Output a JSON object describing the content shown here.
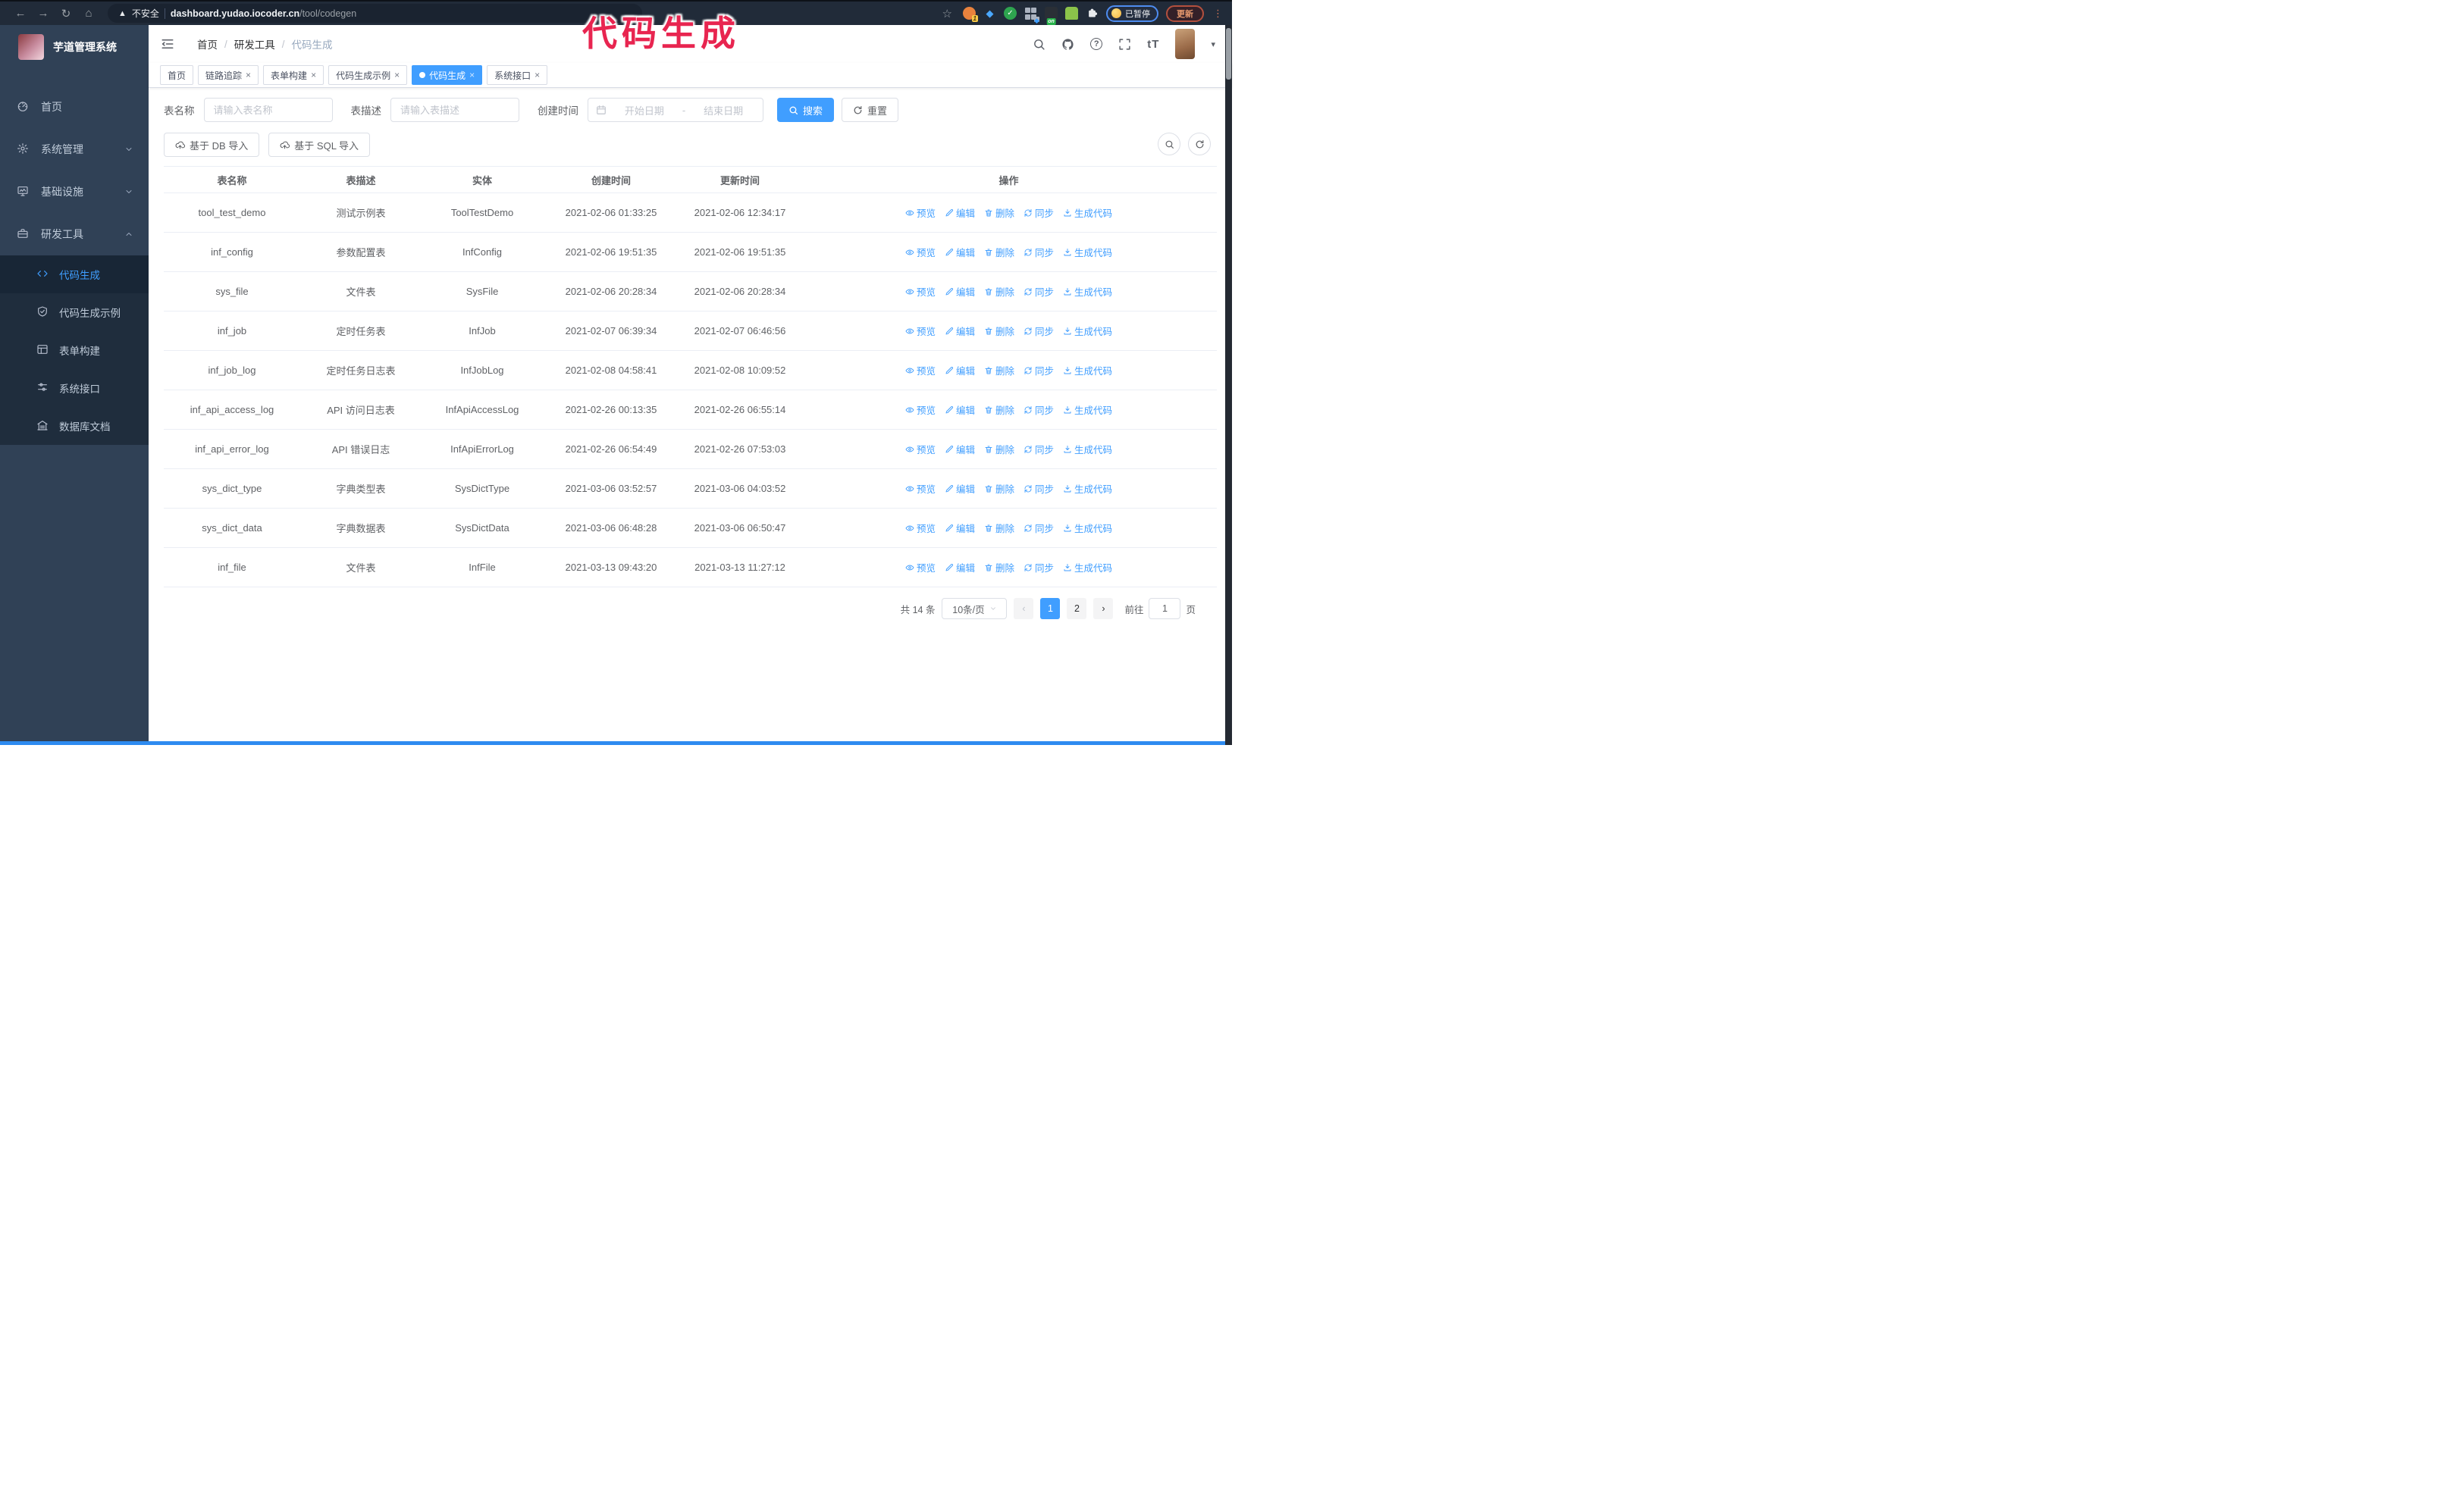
{
  "browser": {
    "security_label": "不安全",
    "url_domain": "dashboard.yudao.iocoder.cn",
    "url_path": "/tool/codegen",
    "paused_label": "已暂停",
    "update_label": "更新",
    "ext_count_badge": "1",
    "ext_on_badge": "on"
  },
  "annotation": {
    "text": "代码生成",
    "color": "#e82550"
  },
  "sidebar": {
    "title": "芋道管理系统",
    "items": [
      {
        "label": "首页",
        "icon": "dashboard",
        "expandable": false
      },
      {
        "label": "系统管理",
        "icon": "gear",
        "expandable": true,
        "expanded": false
      },
      {
        "label": "基础设施",
        "icon": "monitor",
        "expandable": true,
        "expanded": false
      },
      {
        "label": "研发工具",
        "icon": "toolbox",
        "expandable": true,
        "expanded": true
      }
    ],
    "submenu": [
      {
        "label": "代码生成",
        "icon": "code",
        "active": true
      },
      {
        "label": "代码生成示例",
        "icon": "shield",
        "active": false
      },
      {
        "label": "表单构建",
        "icon": "form",
        "active": false
      },
      {
        "label": "系统接口",
        "icon": "sliders",
        "active": false
      },
      {
        "label": "数据库文档",
        "icon": "bank",
        "active": false
      }
    ]
  },
  "header": {
    "breadcrumb": [
      "首页",
      "研发工具",
      "代码生成"
    ],
    "font_size_tool": "tT"
  },
  "tabs": [
    {
      "label": "首页",
      "closable": false,
      "active": false
    },
    {
      "label": "链路追踪",
      "closable": true,
      "active": false
    },
    {
      "label": "表单构建",
      "closable": true,
      "active": false
    },
    {
      "label": "代码生成示例",
      "closable": true,
      "active": false
    },
    {
      "label": "代码生成",
      "closable": true,
      "active": true
    },
    {
      "label": "系统接口",
      "closable": true,
      "active": false
    }
  ],
  "filters": {
    "name_label": "表名称",
    "name_placeholder": "请输入表名称",
    "desc_label": "表描述",
    "desc_placeholder": "请输入表描述",
    "time_label": "创建时间",
    "start_placeholder": "开始日期",
    "range_separator": "-",
    "end_placeholder": "结束日期",
    "search_label": "搜索",
    "reset_label": "重置"
  },
  "toolbar": {
    "import_db_label": "基于 DB 导入",
    "import_sql_label": "基于 SQL 导入"
  },
  "table": {
    "columns": [
      "表名称",
      "表描述",
      "实体",
      "创建时间",
      "更新时间",
      "操作"
    ],
    "actions": [
      "预览",
      "编辑",
      "删除",
      "同步",
      "生成代码"
    ],
    "rows": [
      {
        "name": "tool_test_demo",
        "desc": "测试示例表",
        "entity": "ToolTestDemo",
        "created": "2021-02-06 01:33:25",
        "updated": "2021-02-06 12:34:17"
      },
      {
        "name": "inf_config",
        "desc": "参数配置表",
        "entity": "InfConfig",
        "created": "2021-02-06 19:51:35",
        "updated": "2021-02-06 19:51:35"
      },
      {
        "name": "sys_file",
        "desc": "文件表",
        "entity": "SysFile",
        "created": "2021-02-06 20:28:34",
        "updated": "2021-02-06 20:28:34",
        "created_wrap": true,
        "updated_wrap": true
      },
      {
        "name": "inf_job",
        "desc": "定时任务表",
        "entity": "InfJob",
        "created": "2021-02-07 06:39:34",
        "updated": "2021-02-07 06:46:56",
        "created_wrap": true,
        "updated_wrap": true
      },
      {
        "name": "inf_job_log",
        "desc": "定时任务日志表",
        "entity": "InfJobLog",
        "created": "2021-02-08 04:58:41",
        "updated": "2021-02-08 10:09:52",
        "created_wrap": true,
        "updated_wrap": true
      },
      {
        "name": "inf_api_access_log",
        "desc": "API 访问日志表",
        "entity": "InfApiAccessLog",
        "created": "2021-02-26 00:13:35",
        "updated": "2021-02-26 06:55:14",
        "updated_wrap": true
      },
      {
        "name": "inf_api_error_log",
        "desc": "API 错误日志",
        "entity": "InfApiErrorLog",
        "created": "2021-02-26 06:54:49",
        "updated": "2021-02-26 07:53:03",
        "created_wrap": true,
        "updated_wrap": true
      },
      {
        "name": "sys_dict_type",
        "desc": "字典类型表",
        "entity": "SysDictType",
        "created": "2021-03-06 03:52:57",
        "updated": "2021-03-06 04:03:52",
        "created_wrap": true,
        "updated_wrap": true
      },
      {
        "name": "sys_dict_data",
        "desc": "字典数据表",
        "entity": "SysDictData",
        "created": "2021-03-06 06:48:28",
        "updated": "2021-03-06 06:50:47",
        "created_wrap": true,
        "updated_wrap": true
      },
      {
        "name": "inf_file",
        "desc": "文件表",
        "entity": "InfFile",
        "created": "2021-03-13 09:43:20",
        "updated": "2021-03-13 11:27:12",
        "created_wrap": true
      }
    ]
  },
  "pagination": {
    "total": "共 14 条",
    "page_size": "10条/页",
    "pages": [
      "1",
      "2"
    ],
    "active_page": "1",
    "prev_glyph": "‹",
    "next_glyph": "›",
    "goto_label": "前往",
    "goto_value": "1",
    "goto_suffix": "页"
  },
  "icons": {
    "back-icon": "left arrow ←",
    "forward-icon": "right arrow →",
    "reload-icon": "circular arrow ↻",
    "home-icon": "house ⌂",
    "warning-icon": "triangle ⚠",
    "star-icon": "bookmark star ☆",
    "extensions": [
      "orange-circle",
      "blue-gem",
      "green-check-circle",
      "grid-tiles",
      "dark-on-badge",
      "green-bot",
      "puzzle-piece"
    ],
    "fold-icon": "hamburger with arrow",
    "search-icon": "magnifier",
    "github-icon": "github mark",
    "help-icon": "question circle",
    "fullscreen-icon": "corner brackets",
    "calendar-icon": "calendar",
    "upload-icon": "cloud upload",
    "eye-icon": "eye",
    "edit-icon": "pencil",
    "delete-icon": "trash",
    "sync-icon": "circular arrows",
    "download-icon": "down arrow tray",
    "chevron-down-icon": "∨",
    "chevron-up-icon": "∧",
    "caret-down-icon": "▾",
    "ellipsis-icon": "⋮"
  }
}
